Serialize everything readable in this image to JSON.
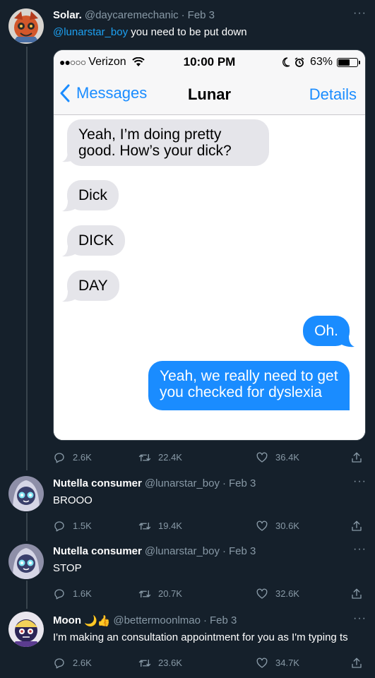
{
  "tweets": [
    {
      "name": "Solar.",
      "handle": "@daycaremechanic",
      "date": "Feb 3",
      "mention": "@lunarstar_boy",
      "text": " you need to be put down",
      "replies": "2.6K",
      "retweets": "22.4K",
      "likes": "36.4K"
    },
    {
      "name": "Nutella consumer",
      "handle": "@lunarstar_boy",
      "date": "Feb 3",
      "text": "BROOO",
      "replies": "1.5K",
      "retweets": "19.4K",
      "likes": "30.6K"
    },
    {
      "name": "Nutella consumer",
      "handle": "@lunarstar_boy",
      "date": "Feb 3",
      "text": "STOP",
      "replies": "1.6K",
      "retweets": "20.7K",
      "likes": "32.6K"
    },
    {
      "name": "Moon",
      "name_emoji": "🌙👍",
      "handle": "@bettermoonlmao",
      "date": "Feb 3",
      "text": "I'm making an consultation appointment for you as I'm typing ts",
      "replies": "2.6K",
      "retweets": "23.6K",
      "likes": "34.7K"
    }
  ],
  "screenshot": {
    "carrier_dots": "●●○○○",
    "carrier": "Verizon",
    "time": "10:00 PM",
    "battery": "63%",
    "battery_level": 0.63,
    "back_label": "Messages",
    "contact": "Lunar",
    "details_label": "Details",
    "messages": [
      {
        "from": "them",
        "text": "Yeah, I’m doing pretty good. How’s your dick?"
      },
      {
        "from": "them",
        "text": "Dick"
      },
      {
        "from": "them",
        "text": "DICK"
      },
      {
        "from": "them",
        "text": "DAY"
      },
      {
        "from": "me",
        "text": "Oh."
      },
      {
        "from": "me",
        "text": "Yeah, we really need to get you checked for dyslexia"
      }
    ]
  },
  "more_label": "···",
  "colors": {
    "background": "#15202b",
    "link": "#1da1f2",
    "muted": "#8899a6",
    "imessage_blue": "#1a8cff",
    "imessage_gray": "#e5e5ea"
  }
}
